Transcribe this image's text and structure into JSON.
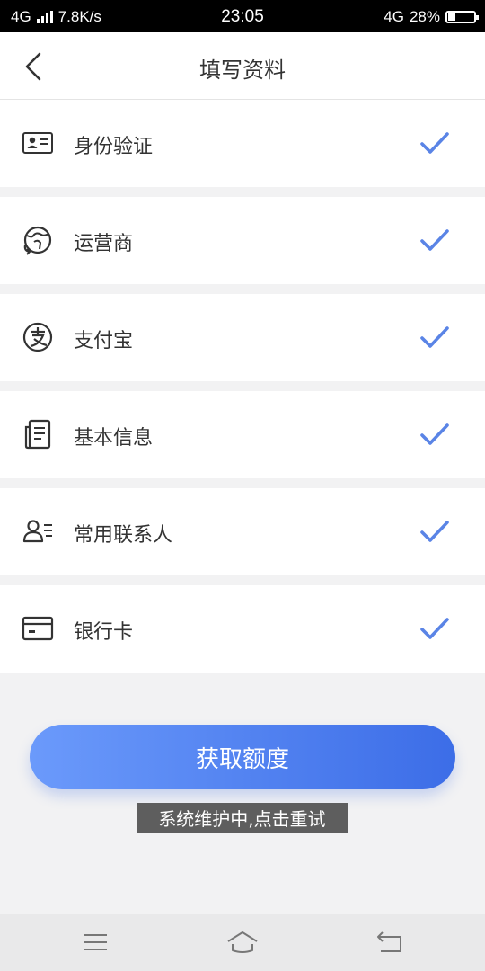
{
  "status_bar": {
    "network": "4G",
    "speed": "7.8K/s",
    "time": "23:05",
    "network_right": "4G",
    "battery": "28%",
    "battery_level": 0.28
  },
  "header": {
    "title": "填写资料",
    "back_icon": "chevron-left-icon"
  },
  "items": [
    {
      "label": "身份验证",
      "icon": "id-card-icon",
      "completed": true
    },
    {
      "label": "运营商",
      "icon": "globe-refresh-icon",
      "completed": true
    },
    {
      "label": "支付宝",
      "icon": "alipay-icon",
      "completed": true
    },
    {
      "label": "基本信息",
      "icon": "document-icon",
      "completed": true
    },
    {
      "label": "常用联系人",
      "icon": "contacts-icon",
      "completed": true
    },
    {
      "label": "银行卡",
      "icon": "bank-card-icon",
      "completed": true
    }
  ],
  "primary_button": {
    "label": "获取额度"
  },
  "toast": {
    "text": "系统维护中,点击重试"
  },
  "colors": {
    "accent": "#4a78e6",
    "check": "#5a84e6",
    "button_start": "#6b9afb",
    "button_end": "#3c6de7"
  },
  "nav_bar": {
    "menu_icon": "menu-icon",
    "home_icon": "home-icon",
    "back_icon": "back-arrow-icon"
  }
}
